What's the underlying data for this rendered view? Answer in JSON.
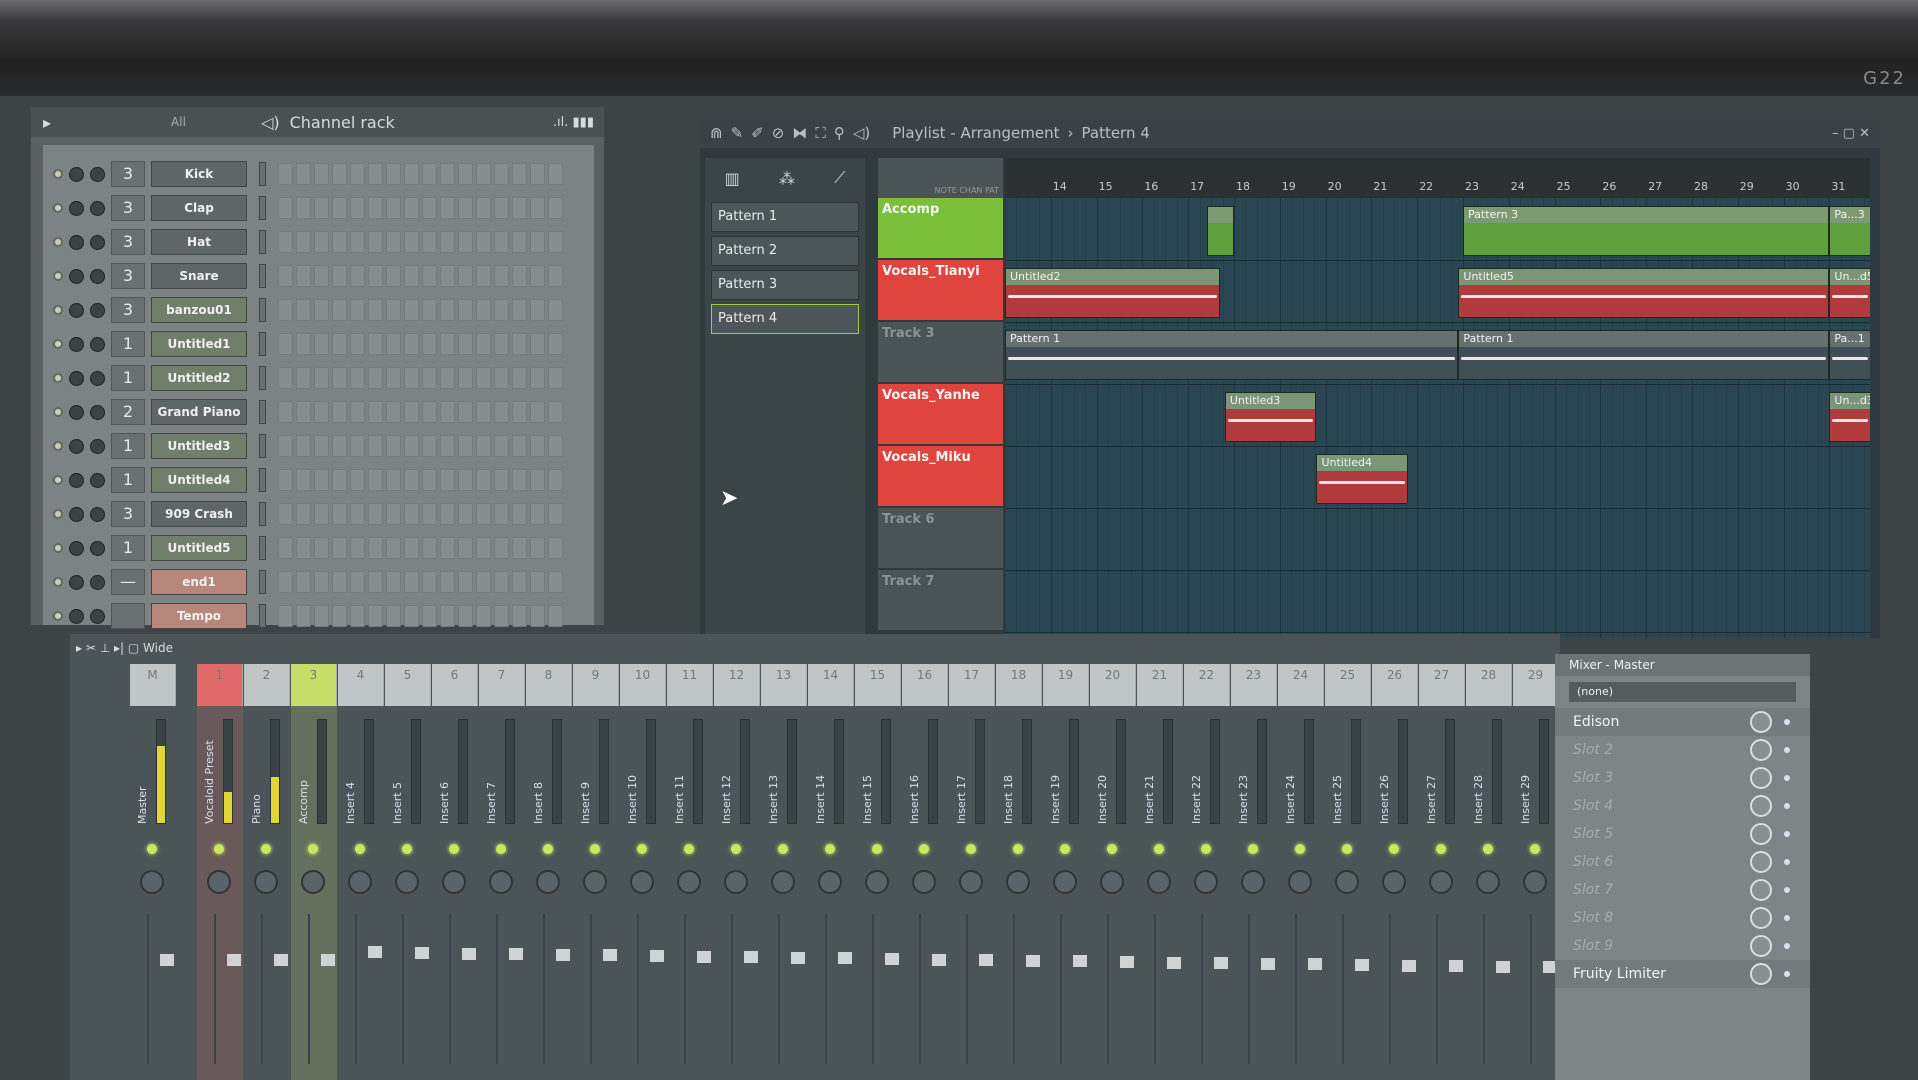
{
  "monitor": {
    "brand": "G22"
  },
  "channel_rack": {
    "filter": "All",
    "title": "Channel rack",
    "channels": [
      {
        "steps": "3",
        "name": "Kick",
        "kind": "dark"
      },
      {
        "steps": "3",
        "name": "Clap",
        "kind": "dark"
      },
      {
        "steps": "3",
        "name": "Hat",
        "kind": "dark"
      },
      {
        "steps": "3",
        "name": "Snare",
        "kind": "dark"
      },
      {
        "steps": "3",
        "name": "banzou01",
        "kind": "audio"
      },
      {
        "steps": "1",
        "name": "Untitled1",
        "kind": "audio"
      },
      {
        "steps": "1",
        "name": "Untitled2",
        "kind": "audio"
      },
      {
        "steps": "2",
        "name": "Grand Piano",
        "kind": "dark"
      },
      {
        "steps": "1",
        "name": "Untitled3",
        "kind": "audio"
      },
      {
        "steps": "1",
        "name": "Untitled4",
        "kind": "audio"
      },
      {
        "steps": "3",
        "name": "909 Crash",
        "kind": "dark"
      },
      {
        "steps": "1",
        "name": "Untitled5",
        "kind": "audio"
      },
      {
        "steps": "—",
        "name": "end1",
        "kind": "red"
      },
      {
        "steps": "",
        "name": "Tempo",
        "kind": "red"
      }
    ]
  },
  "playlist": {
    "title": "Playlist - Arrangement",
    "pattern": "Pattern 4",
    "header_labels": "NOTE CHAN PAT",
    "patterns": [
      "Pattern 1",
      "Pattern 2",
      "Pattern 3",
      "Pattern 4"
    ],
    "active_pattern": 3,
    "bars": [
      14,
      15,
      16,
      17,
      18,
      19,
      20,
      21,
      22,
      23,
      24,
      25,
      26,
      27,
      28,
      29,
      30,
      31
    ],
    "tracks": [
      {
        "name": "Accomp",
        "color": "#7cbf3a"
      },
      {
        "name": "Vocals_Tianyi",
        "color": "#e0443e"
      },
      {
        "name": "Track 3",
        "color": ""
      },
      {
        "name": "Vocals_Yanhe",
        "color": "#e0443e"
      },
      {
        "name": "Vocals_Miku",
        "color": "#e0443e"
      },
      {
        "name": "Track 6",
        "color": ""
      },
      {
        "name": "Track 7",
        "color": ""
      }
    ],
    "clips": [
      {
        "track": 0,
        "label": "",
        "start": 17.4,
        "end": 18,
        "kind": "green"
      },
      {
        "track": 0,
        "label": "Pattern 3",
        "start": 23,
        "end": 31,
        "kind": "green"
      },
      {
        "track": 0,
        "label": "Pa...3",
        "start": 31,
        "end": 31.9,
        "kind": "green"
      },
      {
        "track": 1,
        "label": "Untitled2",
        "start": 13,
        "end": 17.7,
        "kind": "red"
      },
      {
        "track": 1,
        "label": "Untitled5",
        "start": 22.9,
        "end": 31,
        "kind": "red"
      },
      {
        "track": 1,
        "label": "Un...d5",
        "start": 31,
        "end": 31.9,
        "kind": "red"
      },
      {
        "track": 2,
        "label": "Pattern 1",
        "start": 13,
        "end": 22.9,
        "kind": "gray"
      },
      {
        "track": 2,
        "label": "Pattern 1",
        "start": 22.9,
        "end": 31,
        "kind": "gray"
      },
      {
        "track": 2,
        "label": "Pa...1",
        "start": 31,
        "end": 31.9,
        "kind": "gray"
      },
      {
        "track": 3,
        "label": "Untitled3",
        "start": 17.8,
        "end": 19.8,
        "kind": "red"
      },
      {
        "track": 3,
        "label": "Un...d3",
        "start": 31,
        "end": 31.9,
        "kind": "red"
      },
      {
        "track": 4,
        "label": "Untitled4",
        "start": 19.8,
        "end": 21.8,
        "kind": "red"
      }
    ]
  },
  "mixer": {
    "view": "Wide",
    "strips": [
      {
        "num": "M",
        "name": "Master",
        "level": 0.75
      },
      {
        "num": "1",
        "name": "Vocaloid Preset",
        "level": 0.3,
        "color": "#e06a6a"
      },
      {
        "num": "2",
        "name": "Piano",
        "level": 0.45
      },
      {
        "num": "3",
        "name": "Accomp",
        "level": 0,
        "color": "#c8de6a"
      },
      {
        "num": "4",
        "name": "Insert 4"
      },
      {
        "num": "5",
        "name": "Insert 5"
      },
      {
        "num": "6",
        "name": "Insert 6"
      },
      {
        "num": "7",
        "name": "Insert 7"
      },
      {
        "num": "8",
        "name": "Insert 8"
      },
      {
        "num": "9",
        "name": "Insert 9"
      },
      {
        "num": "10",
        "name": "Insert 10"
      },
      {
        "num": "11",
        "name": "Insert 11"
      },
      {
        "num": "12",
        "name": "Insert 12"
      },
      {
        "num": "13",
        "name": "Insert 13"
      },
      {
        "num": "14",
        "name": "Insert 14"
      },
      {
        "num": "15",
        "name": "Insert 15"
      },
      {
        "num": "16",
        "name": "Insert 16"
      },
      {
        "num": "17",
        "name": "Insert 17"
      },
      {
        "num": "18",
        "name": "Insert 18"
      },
      {
        "num": "19",
        "name": "Insert 19"
      },
      {
        "num": "20",
        "name": "Insert 20"
      },
      {
        "num": "21",
        "name": "Insert 21"
      },
      {
        "num": "22",
        "name": "Insert 22"
      },
      {
        "num": "23",
        "name": "Insert 23"
      },
      {
        "num": "24",
        "name": "Insert 24"
      },
      {
        "num": "25",
        "name": "Insert 25"
      },
      {
        "num": "26",
        "name": "Insert 26"
      },
      {
        "num": "27",
        "name": "Insert 27"
      },
      {
        "num": "28",
        "name": "Insert 28"
      },
      {
        "num": "29",
        "name": "Insert 29"
      }
    ]
  },
  "mixer_master": {
    "title": "Mixer - Master",
    "input": "(none)",
    "slots": [
      {
        "name": "Edison",
        "used": true
      },
      {
        "name": "Slot 2"
      },
      {
        "name": "Slot 3"
      },
      {
        "name": "Slot 4"
      },
      {
        "name": "Slot 5"
      },
      {
        "name": "Slot 6"
      },
      {
        "name": "Slot 7"
      },
      {
        "name": "Slot 8"
      },
      {
        "name": "Slot 9"
      },
      {
        "name": "Fruity Limiter",
        "used": true
      }
    ]
  }
}
